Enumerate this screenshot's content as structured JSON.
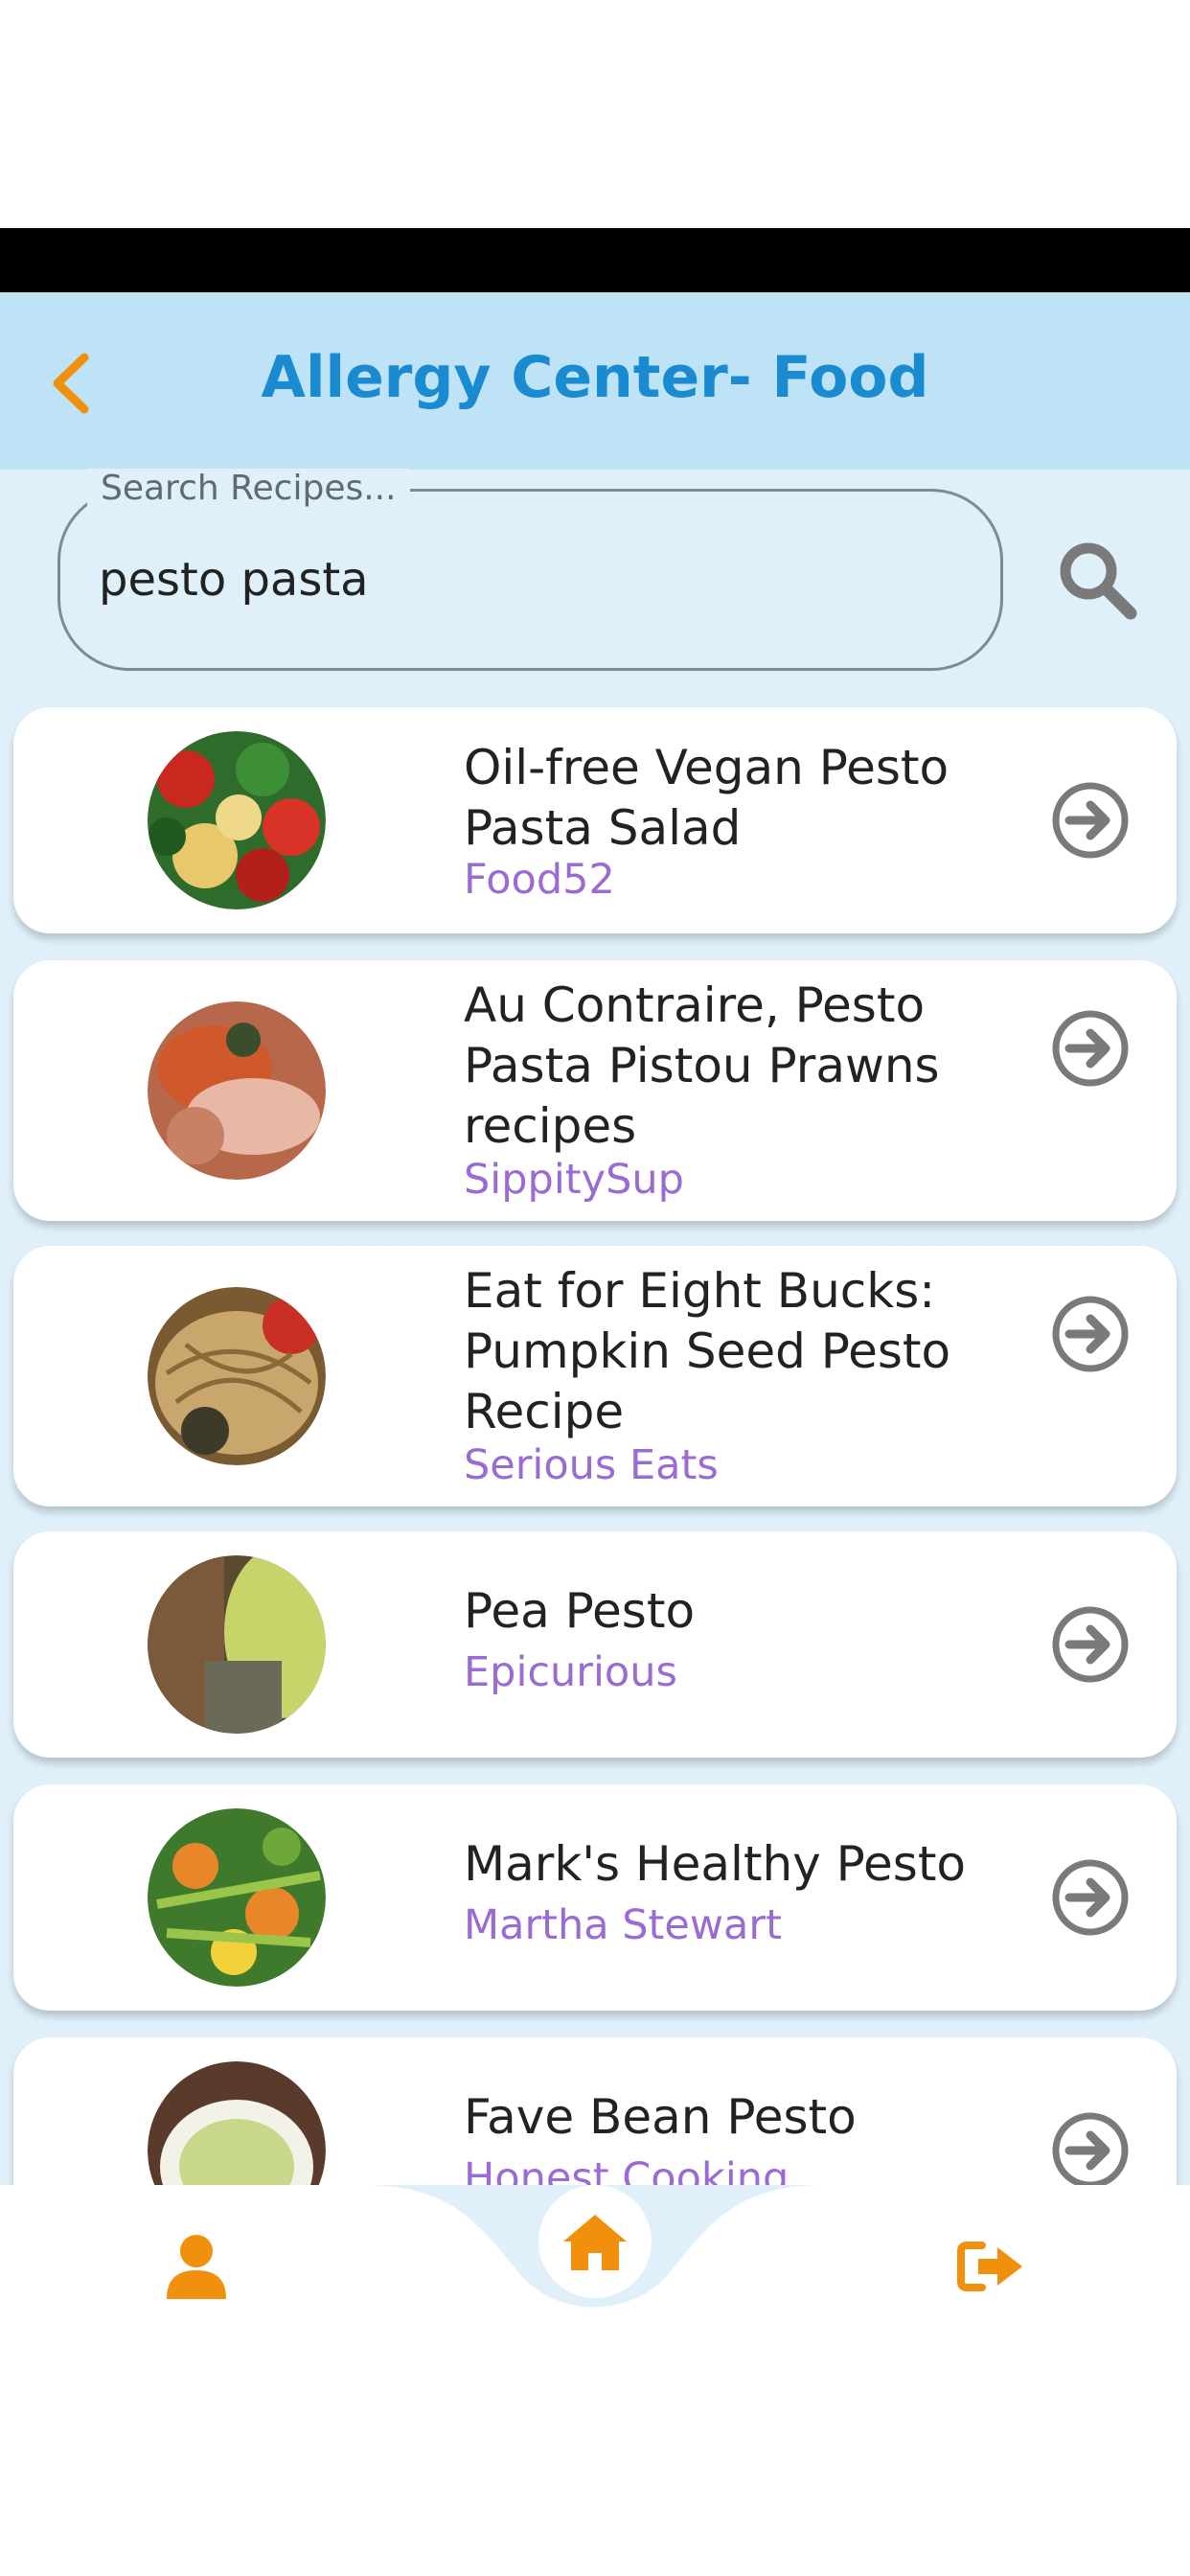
{
  "header": {
    "title": "Allergy Center- Food"
  },
  "search": {
    "label": "Search Recipes...",
    "value": "pesto pasta"
  },
  "recipes": [
    {
      "title_lines": [
        "Oil-free Vegan Pesto",
        "Pasta Salad"
      ],
      "source": "Food52"
    },
    {
      "title_lines": [
        "Au Contraire, Pesto",
        "Pasta Pistou Prawns",
        "recipes"
      ],
      "source": "SippitySup"
    },
    {
      "title_lines": [
        "Eat for Eight Bucks:",
        "Pumpkin Seed Pesto",
        "Recipe"
      ],
      "source": "Serious Eats"
    },
    {
      "title_lines": [
        "Pea Pesto"
      ],
      "source": "Epicurious"
    },
    {
      "title_lines": [
        "Mark's Healthy Pesto"
      ],
      "source": "Martha Stewart"
    },
    {
      "title_lines": [
        "Fave Bean Pesto"
      ],
      "source": "Honest Cooking"
    }
  ],
  "icons": {
    "back": "chevron-left-icon",
    "search": "magnifier-icon",
    "go": "arrow-circle-right-icon",
    "profile": "user-icon",
    "home": "home-icon",
    "logout": "sign-out-icon"
  },
  "colors": {
    "accent": "#f0900c",
    "title": "#1a8ad1",
    "source": "#9a6bd3",
    "appbar": "#bfe3f6",
    "list_bg": "#dff0fa"
  }
}
